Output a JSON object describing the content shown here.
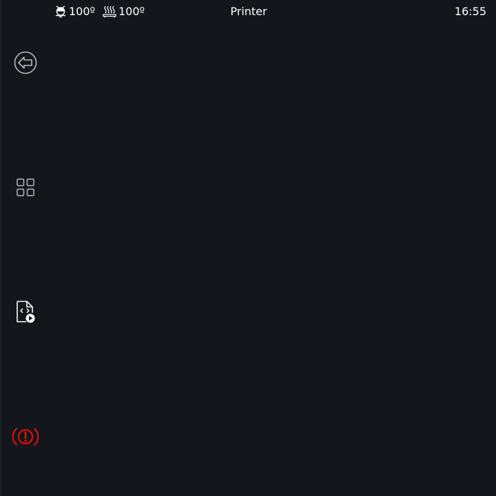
{
  "topbar": {
    "extruder_temp": "100º",
    "bed_temp": "100º",
    "title": "Printer",
    "clock": "16:55"
  },
  "sidebar": {
    "items": [
      {
        "name": "back",
        "icon": "back-arrow-circle-icon"
      },
      {
        "name": "main-menu",
        "icon": "grid-icon"
      },
      {
        "name": "macros",
        "icon": "file-code-play-icon"
      },
      {
        "name": "emergency-stop",
        "icon": "emergency-stop-icon"
      }
    ]
  },
  "colors": {
    "background": "#13171b",
    "foreground": "#ffffff",
    "icon_muted": "#b8bcc0",
    "emergency": "#e10d0d"
  }
}
